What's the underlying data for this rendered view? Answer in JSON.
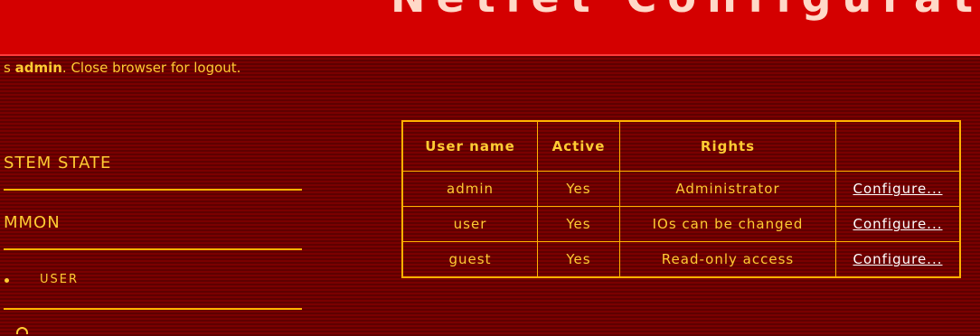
{
  "header": {
    "title": "Netlet Configurat"
  },
  "login": {
    "prefix": "s ",
    "user": "admin",
    "suffix": ". Close browser for logout."
  },
  "nav": {
    "system_state": "STEM STATE",
    "common": "MMON",
    "user": "USER"
  },
  "users_table": {
    "headers": [
      "User name",
      "Active",
      "Rights",
      ""
    ],
    "rows": [
      {
        "name": "admin",
        "active": "Yes",
        "rights": "Administrator",
        "action": "Configure..."
      },
      {
        "name": "user",
        "active": "Yes",
        "rights": "IOs can be changed",
        "action": "Configure..."
      },
      {
        "name": "guest",
        "active": "Yes",
        "rights": "Read-only access",
        "action": "Configure..."
      }
    ]
  },
  "colors": {
    "background": "#6e0000",
    "header": "#d40000",
    "text": "#ffcc33",
    "rule": "#ffb300",
    "link": "#ffffff"
  }
}
